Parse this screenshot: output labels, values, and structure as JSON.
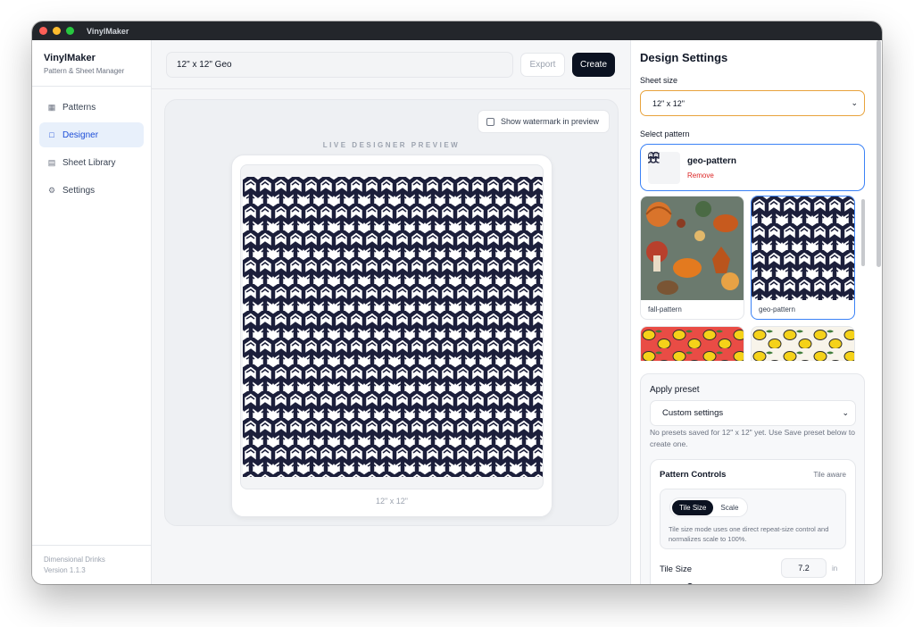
{
  "window": {
    "title": "VinylMaker"
  },
  "sidebar": {
    "brand_name": "VinylMaker",
    "brand_sub": "Pattern & Sheet Manager",
    "items": [
      {
        "label": "Patterns",
        "icon": "grid-icon"
      },
      {
        "label": "Designer",
        "icon": "square-icon"
      },
      {
        "label": "Sheet Library",
        "icon": "library-icon"
      },
      {
        "label": "Settings",
        "icon": "gear-icon"
      }
    ],
    "active_item": "Designer",
    "footer_company": "Dimensional Drinks",
    "footer_version": "Version 1.1.3"
  },
  "toolbar": {
    "design_name": "12\" x 12\" Geo",
    "export_label": "Export",
    "create_label": "Create"
  },
  "preview": {
    "watermark_label": "Show watermark in preview",
    "watermark_checked": false,
    "live_label": "LIVE DESIGNER PREVIEW",
    "sheet_size_caption": "12\" x 12\""
  },
  "settings": {
    "title": "Design Settings",
    "sheet_size_label": "Sheet size",
    "sheet_size_value": "12\" x 12\"",
    "select_pattern_label": "Select pattern",
    "selected_pattern": {
      "name": "geo-pattern",
      "remove_label": "Remove"
    },
    "patterns": [
      {
        "name": "fall-pattern",
        "selected": false
      },
      {
        "name": "geo-pattern",
        "selected": true
      },
      {
        "name": "",
        "selected": false
      },
      {
        "name": "",
        "selected": false
      }
    ],
    "apply_preset_label": "Apply preset",
    "preset_value": "Custom settings",
    "preset_note": "No presets saved for 12\" x 12\" yet. Use Save preset below to create one.",
    "pattern_controls": {
      "title": "Pattern Controls",
      "badge": "Tile aware",
      "modes": [
        "Tile Size",
        "Scale"
      ],
      "active_mode": "Tile Size",
      "help": "Tile size mode uses one direct repeat-size control and normalizes scale to 100%.",
      "tile_size_label": "Tile Size",
      "tile_size_value": "7.2",
      "tile_size_unit": "in"
    }
  },
  "colors": {
    "accent": "#1d4ed8",
    "primary_button": "#0b1221",
    "focus_ring": "#e8a33d",
    "selection_border": "#3b82f6",
    "remove": "#dc2626",
    "pattern_navy": "#1c1f3b"
  }
}
